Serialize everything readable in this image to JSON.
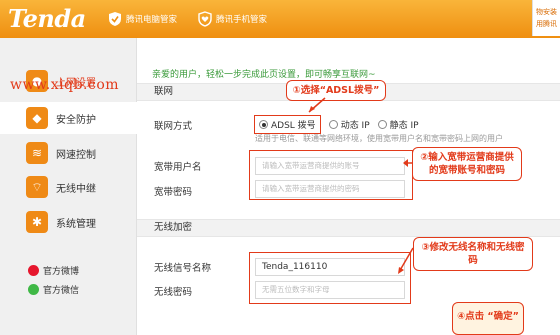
{
  "header": {
    "logo": "Tenda",
    "partner1": "腾讯电脑管家",
    "partner2": "腾讯手机管家",
    "topright_line1": "物安装",
    "topright_line2": "用腾讯"
  },
  "watermark": "www.xiqb.com",
  "sidebar": {
    "items": [
      {
        "label": "上网设置",
        "icon": "globe-icon"
      },
      {
        "label": "安全防护",
        "icon": "shield-icon"
      },
      {
        "label": "网速控制",
        "icon": "speed-icon"
      },
      {
        "label": "无线中继",
        "icon": "wifi-icon"
      },
      {
        "label": "系统管理",
        "icon": "gear-icon"
      }
    ],
    "social": [
      {
        "label": "官方微博",
        "icon": "weibo-icon",
        "color": "#e6162d"
      },
      {
        "label": "官方微信",
        "icon": "wechat-icon",
        "color": "#3fb846"
      }
    ]
  },
  "main": {
    "tip": "亲爱的用户，轻松一步完成此页设置，即可畅享互联网~",
    "section_wan": "联网",
    "section_wifi": "无线加密",
    "conn_label": "联网方式",
    "options": [
      "ADSL 拨号",
      "动态 IP",
      "静态 IP"
    ],
    "selected_option": "ADSL 拨号",
    "hint": "适用于电信、联通等网络环境，使用宽带用户名和宽带密码上网的用户",
    "user_label": "宽带用户名",
    "user_placeholder": "请输入宽带运营商提供的账号",
    "pass_label": "宽带密码",
    "pass_placeholder": "请输入宽带运营商提供的密码",
    "ssid_label": "无线信号名称",
    "ssid_value": "Tenda_116110",
    "wifi_pass_label": "无线密码",
    "wifi_pass_placeholder": "无需五位数字和字母"
  },
  "callouts": {
    "c1": "①选择“ADSL拨号”",
    "c2_line1": "②输入宽带运营商提供",
    "c2_line2": "的宽带账号和密码",
    "c3": "③修改无线名称和无线密码",
    "c4": "④点击 “确定”"
  },
  "colors": {
    "accent": "#f7a21b",
    "callout": "#e23a1a"
  }
}
